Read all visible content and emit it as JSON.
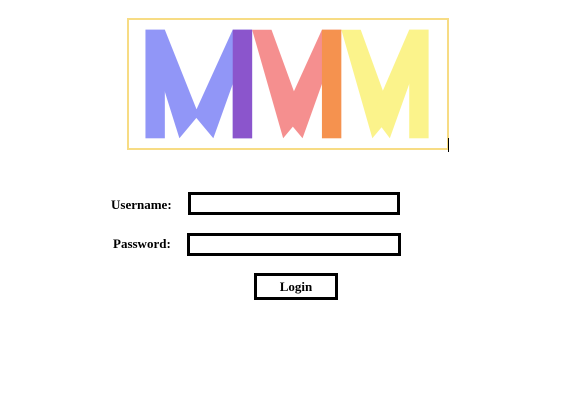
{
  "logo": {
    "text": "MMM",
    "colors": {
      "border": "#f7dc84",
      "first_m": "#9196f7",
      "first_overlap": "#8b55cc",
      "second_m": "#f58f8f",
      "second_overlap": "#f5924f",
      "third_m": "#fbf38b"
    }
  },
  "form": {
    "username": {
      "label": "Username:",
      "value": "",
      "placeholder": ""
    },
    "password": {
      "label": "Password:",
      "value": "",
      "placeholder": ""
    },
    "login_label": "Login"
  }
}
